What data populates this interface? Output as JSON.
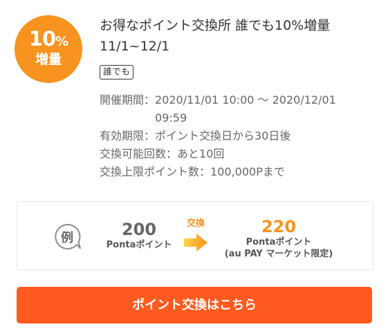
{
  "badge": {
    "percent": "10",
    "percent_sign": "%",
    "label": "増量",
    "color": "#f7931e"
  },
  "campaign": {
    "title": "お得なポイント交換所 誰でも10%増量 11/1~12/1",
    "tag": "誰でも"
  },
  "details": {
    "period_label": "開催期間：",
    "period_value": "2020/11/01 10:00 〜 2020/12/01 09:59",
    "validity_label": "有効期限：",
    "validity_value": "ポイント交換日から30日後",
    "count_label": "交換可能回数：",
    "count_value": "あと10回",
    "limit_label": "交換上限ポイント数：",
    "limit_value": "100,000Pまで"
  },
  "example": {
    "icon_text": "例",
    "from_amount": "200",
    "from_unit": "Pontaポイント",
    "arrow_label": "交換",
    "to_amount": "220",
    "to_unit": "Pontaポイント",
    "to_note": "(au PAY マーケット限定)"
  },
  "cta": {
    "label": "ポイント交換はこちら",
    "color": "#ff5a1f"
  }
}
